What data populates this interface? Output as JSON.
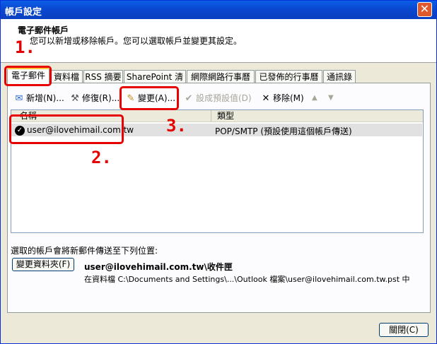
{
  "window": {
    "title": "帳戶設定",
    "close_label": "✕"
  },
  "header": {
    "title": "電子郵件帳戶",
    "subtitle": "您可以新增或移除帳戶。您可以選取帳戶並變更其設定。"
  },
  "tabs": [
    {
      "label": "電子郵件"
    },
    {
      "label": "資料檔"
    },
    {
      "label": "RSS 摘要"
    },
    {
      "label": "SharePoint 清單"
    },
    {
      "label": "網際網路行事曆"
    },
    {
      "label": "已發佈的行事曆"
    },
    {
      "label": "通訊錄"
    }
  ],
  "toolbar": {
    "new_label": "新增(N)...",
    "repair_label": "修復(R)...",
    "change_label": "變更(A)...",
    "set_default_label": "設成預設值(D)",
    "remove_label": "移除(M)",
    "up_arrow": "▲",
    "down_arrow": "▼"
  },
  "table": {
    "columns": [
      "名稱",
      "類型"
    ],
    "rows": [
      {
        "name": "user@ilovehimail.com.tw",
        "type": "POP/SMTP (預設使用這個帳戶傳送)"
      }
    ]
  },
  "delivery": {
    "label": "選取的帳戶會將新郵件傳送至下列位置:",
    "change_folder_label": "變更資料夾(F)",
    "folder_name": "user@ilovehimail.com.tw\\收件匣",
    "folder_path": "在資料檔 C:\\Documents and Settings\\...\\Outlook 檔案\\user@ilovehimail.com.tw.pst 中"
  },
  "footer": {
    "close_label": "關閉(C)"
  },
  "annotations": {
    "step1": "1.",
    "step2": "2.",
    "step3": "3."
  },
  "colors": {
    "annotation": "#e60000",
    "titlebar": "#0a5fe6"
  }
}
